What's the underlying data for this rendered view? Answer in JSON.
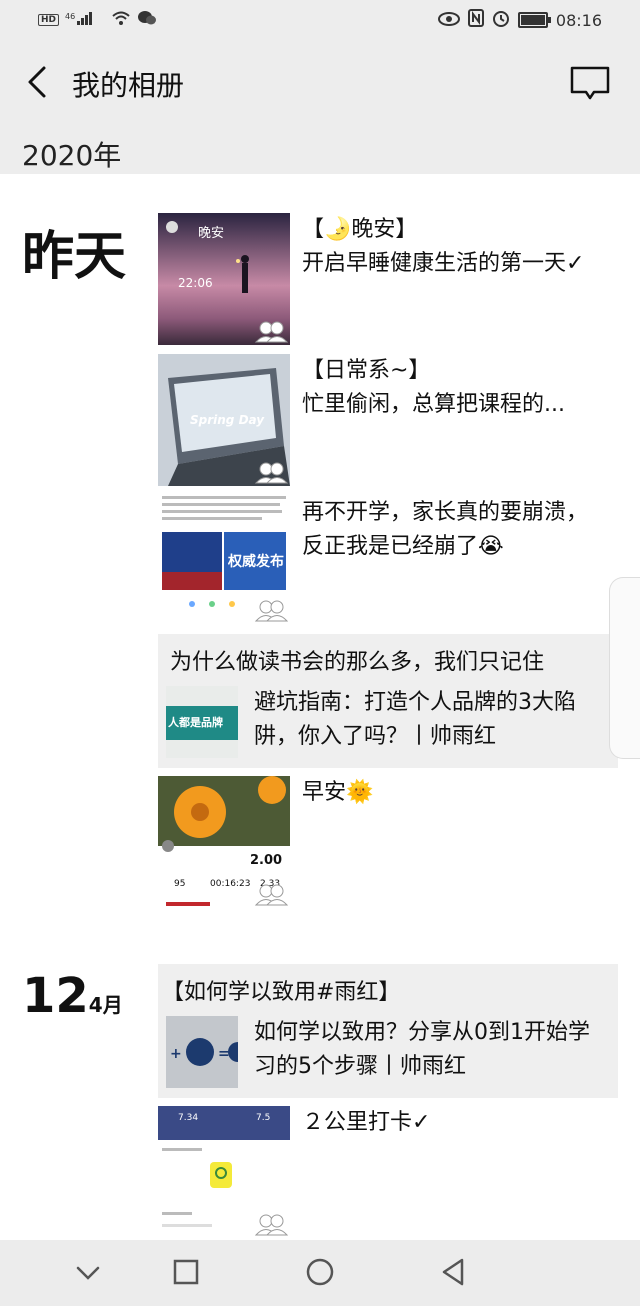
{
  "status_bar": {
    "left_labels": [
      "HD",
      "46"
    ],
    "time": "08:16",
    "icons": [
      "hd-icon",
      "signal-icon",
      "wifi-icon",
      "wechat-icon",
      "eye-icon",
      "nfc-icon",
      "alarm-icon",
      "battery-icon"
    ],
    "battery_level": 1.0
  },
  "header": {
    "title": "我的相册"
  },
  "year": "2020年",
  "days": [
    {
      "label": "昨天"
    },
    {
      "day": "12",
      "month": "4月"
    }
  ],
  "posts": [
    {
      "text": "【🌛晚安】\n开启早睡健康生活的第一天✓",
      "thumb_text": "晚安"
    },
    {
      "text": "【日常系~】\n忙里偷闲，总算把课程的...",
      "thumb_text": "Spring Day"
    },
    {
      "text": "再不开学，家长真的要崩溃，\n反正我是已经崩了😭",
      "thumb_text": "权威发布"
    },
    {
      "text": "早安🌞",
      "thumb_stats": [
        "2.00",
        "95",
        "00:16:23",
        "2.33"
      ]
    },
    {
      "text": "２公里打卡✓",
      "thumb_stats": [
        "7.34",
        "7.5"
      ]
    }
  ],
  "shares": [
    {
      "title": "为什么做读书会的那么多，我们只记住",
      "desc": "避坑指南：打造个人品牌的3大陷阱，你入了吗？丨帅雨红",
      "thumb_text": "人都是品牌"
    },
    {
      "title": "【如何学以致用#雨红】",
      "desc": "如何学以致用？分享从0到1开始学习的5个步骤丨帅雨红"
    }
  ],
  "colors": {
    "bar_bg": "#ededed",
    "share_bg": "#efefef",
    "text": "#111111"
  }
}
